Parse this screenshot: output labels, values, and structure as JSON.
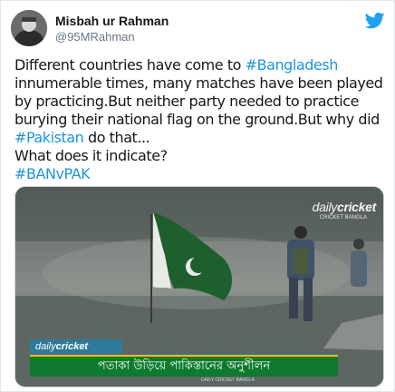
{
  "author": {
    "name": "Misbah ur Rahman",
    "handle": "@95MRahman"
  },
  "tweet": {
    "text_1": "Different countries have come to ",
    "hashtag_1": "#Bangladesh",
    "text_2": " innumerable times, many matches have been played by practicing.But neither party needed to practice burying their national flag on the ground.But why did ",
    "hashtag_2": "#Pakistan",
    "text_3": " do that...",
    "text_4": "What does it indicate?",
    "hashtag_3": "#BANvPAK"
  },
  "media": {
    "watermark_prefix": "daily",
    "watermark_suffix": "cricket",
    "watermark_sub": "CRICKET BANGLA",
    "logo_prefix": "daily",
    "logo_suffix": "cricket",
    "caption": "পতাকা উড়িয়ে পাকিস্তানের অনুশীলন",
    "caption_sub": "DAILY CRICKET BANGLA"
  },
  "colors": {
    "link": "#1b95e0",
    "twitter_blue": "#1da1f2",
    "caption_green": "#0d7a2e",
    "caption_border": "#f2c200"
  },
  "icons": {
    "twitter": "twitter-bird-icon"
  }
}
